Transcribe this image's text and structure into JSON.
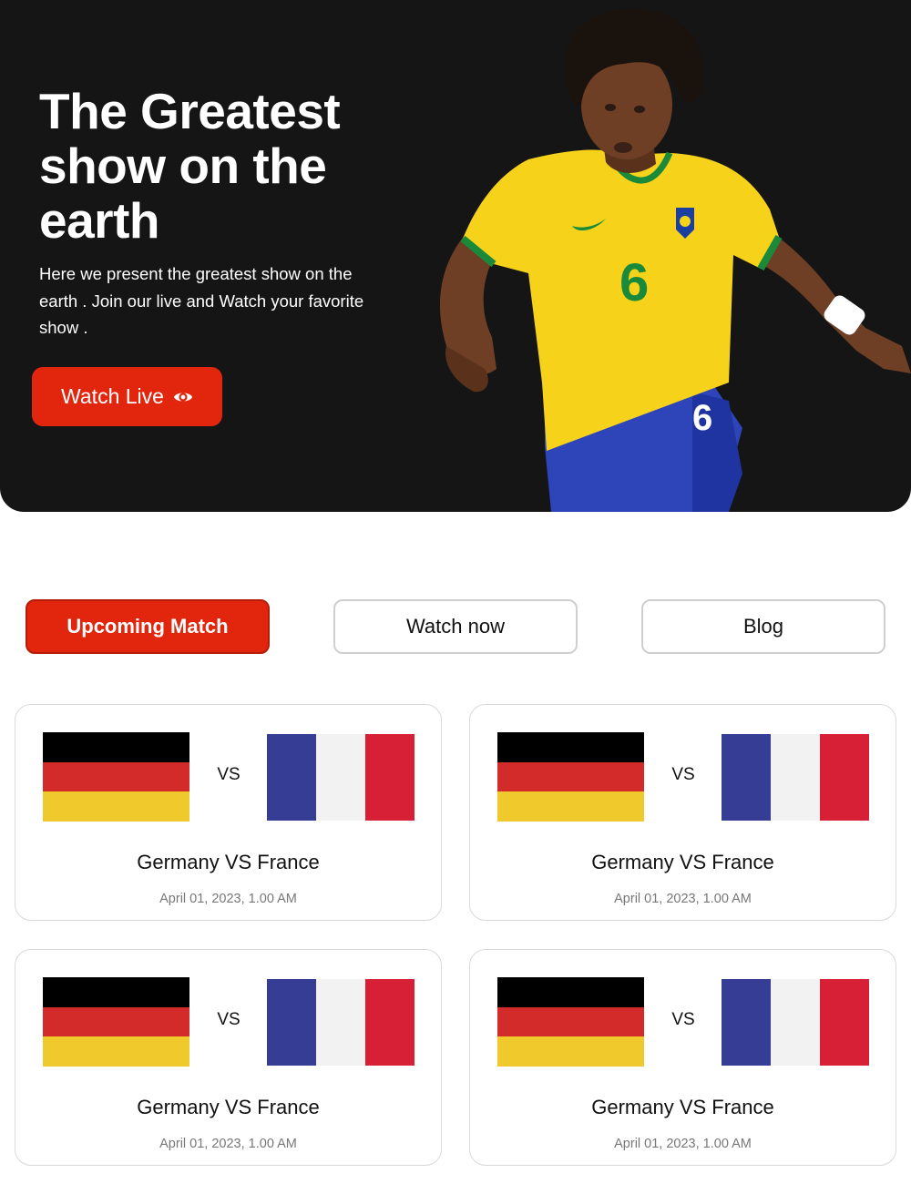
{
  "hero": {
    "title": "The Greatest show on the earth",
    "description": "Here we present the greatest show on the earth . Join our live and Watch your favorite show .",
    "cta_label": "Watch Live",
    "cta_icon": "eye-icon",
    "player_jersey_number": "6"
  },
  "tabs": [
    {
      "label": "Upcoming Match",
      "active": true
    },
    {
      "label": "Watch now",
      "active": false
    },
    {
      "label": "Blog",
      "active": false
    }
  ],
  "matches": [
    {
      "vs": "VS",
      "title": "Germany VS France",
      "date": "April 01, 2023, 1.00 AM"
    },
    {
      "vs": "VS",
      "title": "Germany VS France",
      "date": "April 01, 2023, 1.00 AM"
    },
    {
      "vs": "VS",
      "title": "Germany VS France",
      "date": "April 01, 2023, 1.00 AM"
    },
    {
      "vs": "VS",
      "title": "Germany VS France",
      "date": "April 01, 2023, 1.00 AM"
    }
  ],
  "colors": {
    "accent": "#e1260d",
    "hero_bg": "#151515",
    "germany": [
      "#000000",
      "#d32a2a",
      "#f0c92c"
    ],
    "france": [
      "#353e94",
      "#f2f2f2",
      "#d71f35"
    ]
  }
}
